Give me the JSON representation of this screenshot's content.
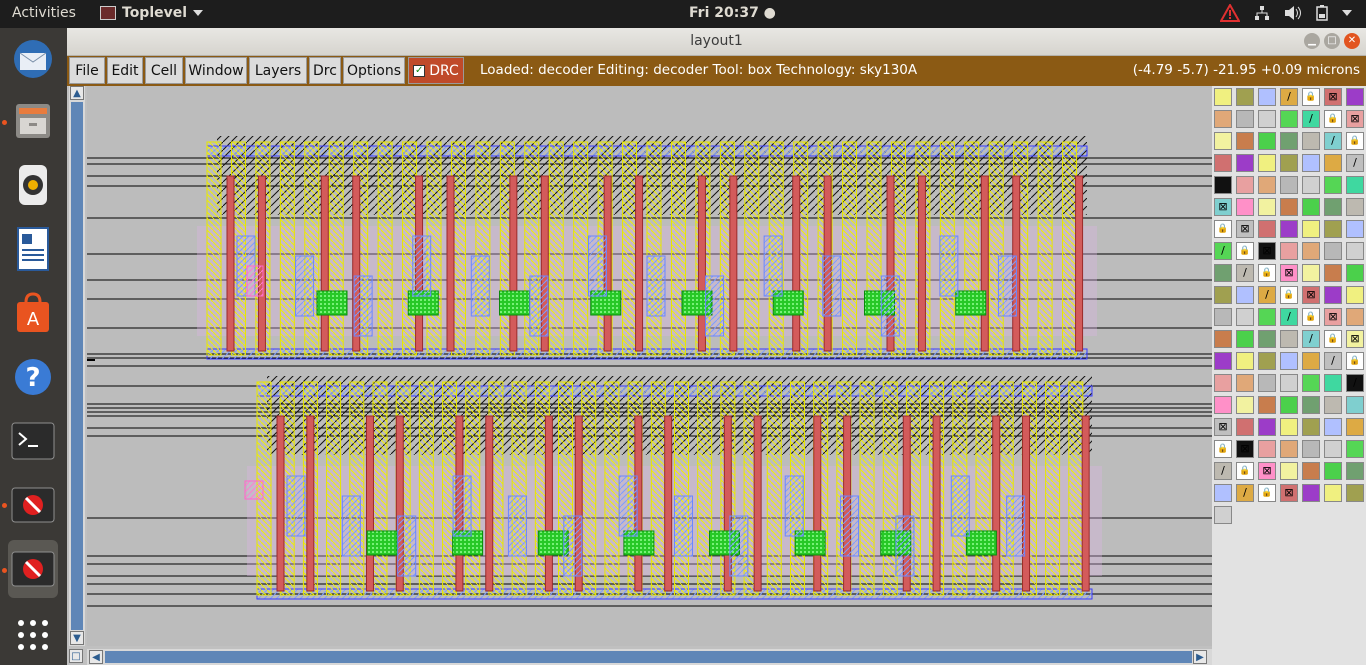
{
  "topbar": {
    "activities": "Activities",
    "app_menu": "Toplevel",
    "clock": "Fri 20:37 ●"
  },
  "dock": {
    "items": [
      "thunderbird-icon",
      "files-icon",
      "rhythmbox-icon",
      "writer-icon",
      "software-icon",
      "help-icon",
      "terminal-icon",
      "magic-window-icon",
      "magic-window-icon"
    ]
  },
  "window": {
    "title": "layout1"
  },
  "menu": {
    "file": "File",
    "edit": "Edit",
    "cell": "Cell",
    "window": "Window",
    "layers": "Layers",
    "drc": "Drc",
    "options": "Options",
    "drc_toggle": "DRC"
  },
  "status": {
    "text": "Loaded: decoder Editing: decoder Tool: box  Technology: sky130A",
    "coords": "(-4.79 -5.7) -21.95 +0.09 microns"
  },
  "colors": {
    "menubar": "#8b5a14",
    "poly": "#d05050",
    "metal1": "#b8b8ff",
    "local_interconnect": "#ffff00",
    "diff": "#20c020",
    "nwell": "#ff99cc"
  }
}
